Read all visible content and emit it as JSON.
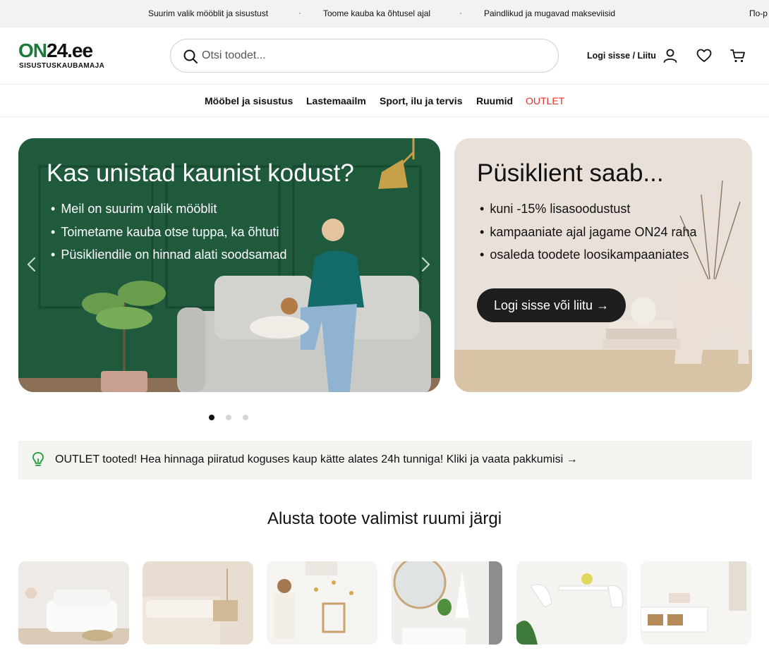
{
  "topbar": {
    "messages": [
      "Suurim valik mööblit ja sisustust",
      "Toome kauba ka õhtusel ajal",
      "Paindlikud ja mugavad makseviisid",
      "По-р"
    ],
    "separator": "·"
  },
  "header": {
    "logo_brand": "ON",
    "logo_number": "24.ee",
    "logo_subtitle": "SISUSTUSKAUBAMAJA",
    "search_placeholder": "Otsi toodet...",
    "login_label": "Logi sisse / Liitu",
    "icons": [
      "search-icon",
      "user-icon",
      "heart-icon",
      "cart-icon"
    ]
  },
  "nav": {
    "items": [
      "Mööbel ja sisustus",
      "Lastemaailm",
      "Sport, ilu ja tervis",
      "Ruumid",
      "OUTLET"
    ]
  },
  "hero": {
    "title": "Kas unistad kaunist kodust?",
    "bullets": [
      "Meil on suurim valik mööblit",
      "Toimetame kauba otse tuppa, ka õhtuti",
      "Püsikliendile on hinnad alati soodsamad"
    ],
    "slides_total": 3,
    "active_slide": 1
  },
  "promo": {
    "title": "Püsiklient saab...",
    "bullets": [
      "kuni -15% lisasoodustust",
      "kampaaniate ajal jagame ON24 raha",
      "osaleda toodete loosikampaaniates"
    ],
    "cta_label": "Logi sisse või liitu →"
  },
  "outlet_banner": {
    "text": "OUTLET tooted! Hea hinnaga piiratud koguses kaup kätte alates 24h tunniga! Kliki ja vaata pakkumisi →"
  },
  "rooms": {
    "title": "Alusta toote valimist ruumi järgi",
    "count": 6
  },
  "colors": {
    "brand_green": "#1f7a3a",
    "outlet_red": "#e5312b",
    "hero_green": "#1f5a3c",
    "dark_button": "#1e1e1e"
  }
}
